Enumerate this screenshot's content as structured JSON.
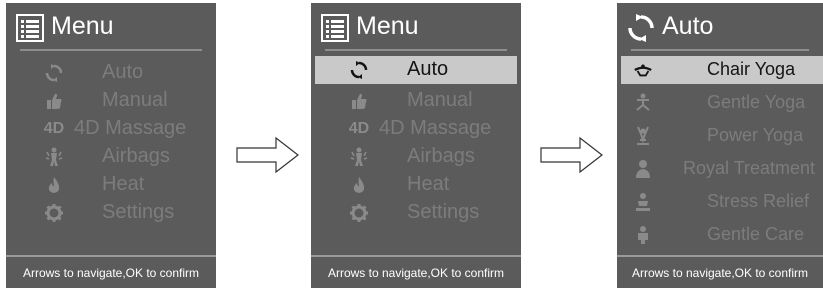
{
  "main_menu": {
    "title": "Menu",
    "items": [
      {
        "label": "Auto",
        "icon": "auto-cycle-icon"
      },
      {
        "label": "Manual",
        "icon": "thumb-icon"
      },
      {
        "label": "4D Massage",
        "icon": "4d-icon",
        "icon_text": "4D"
      },
      {
        "label": "Airbags",
        "icon": "airbag-icon"
      },
      {
        "label": "Heat",
        "icon": "flame-icon"
      },
      {
        "label": "Settings",
        "icon": "gear-icon"
      }
    ],
    "selected_index_screen_1": null,
    "selected_index_screen_2": 0
  },
  "auto_menu": {
    "title": "Auto",
    "items": [
      {
        "label": "Chair Yoga",
        "icon": "chair-yoga-icon"
      },
      {
        "label": "Gentle Yoga",
        "icon": "gentle-yoga-icon"
      },
      {
        "label": "Power Yoga",
        "icon": "power-yoga-icon"
      },
      {
        "label": "Royal Treatment",
        "icon": "royal-treatment-icon"
      },
      {
        "label": "Stress Relief",
        "icon": "stress-relief-icon"
      },
      {
        "label": "Gentle Care",
        "icon": "gentle-care-icon"
      }
    ],
    "selected_index": 0
  },
  "footer": "Arrows to navigate,OK to confirm",
  "colors": {
    "screen_bg": "#5b5b5b",
    "selected_bg": "#c9c9c9",
    "selected_text": "#141414",
    "inactive_text": "#7c7c7c",
    "header_text": "#ffffff"
  }
}
